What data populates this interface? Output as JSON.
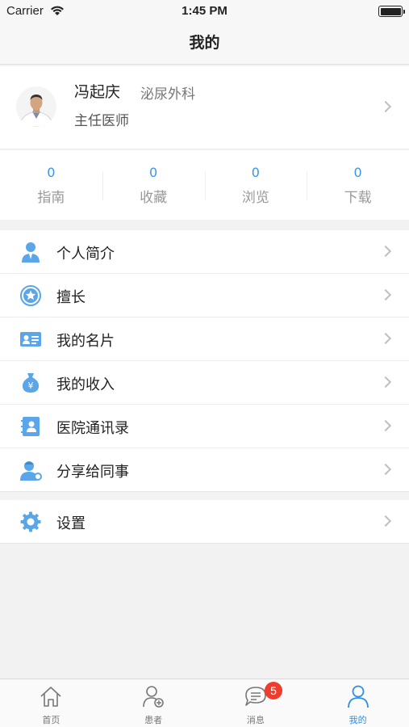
{
  "status": {
    "carrier": "Carrier",
    "time": "1:45 PM",
    "battery_level": 1.0
  },
  "nav": {
    "title": "我的"
  },
  "profile": {
    "name": "冯起庆",
    "department": "泌尿外科",
    "title": "主任医师"
  },
  "stats": [
    {
      "value": "0",
      "label": "指南"
    },
    {
      "value": "0",
      "label": "收藏"
    },
    {
      "value": "0",
      "label": "浏览"
    },
    {
      "value": "0",
      "label": "下载"
    }
  ],
  "menu": [
    {
      "label": "个人简介",
      "icon": "person-icon"
    },
    {
      "label": "擅长",
      "icon": "star-badge-icon"
    },
    {
      "label": "我的名片",
      "icon": "business-card-icon"
    },
    {
      "label": "我的收入",
      "icon": "money-bag-icon"
    },
    {
      "label": "医院通讯录",
      "icon": "address-book-icon"
    },
    {
      "label": "分享给同事",
      "icon": "share-doctor-icon"
    }
  ],
  "settings": {
    "label": "设置",
    "icon": "gear-icon"
  },
  "tabs": [
    {
      "label": "首页",
      "icon": "home-icon"
    },
    {
      "label": "患者",
      "icon": "patient-icon"
    },
    {
      "label": "消息",
      "icon": "message-icon",
      "badge": "5"
    },
    {
      "label": "我的",
      "icon": "profile-icon",
      "active": true
    }
  ],
  "colors": {
    "accent": "#3b96e6",
    "icon_blue": "#5aa6e8",
    "badge": "#f03b2f"
  }
}
